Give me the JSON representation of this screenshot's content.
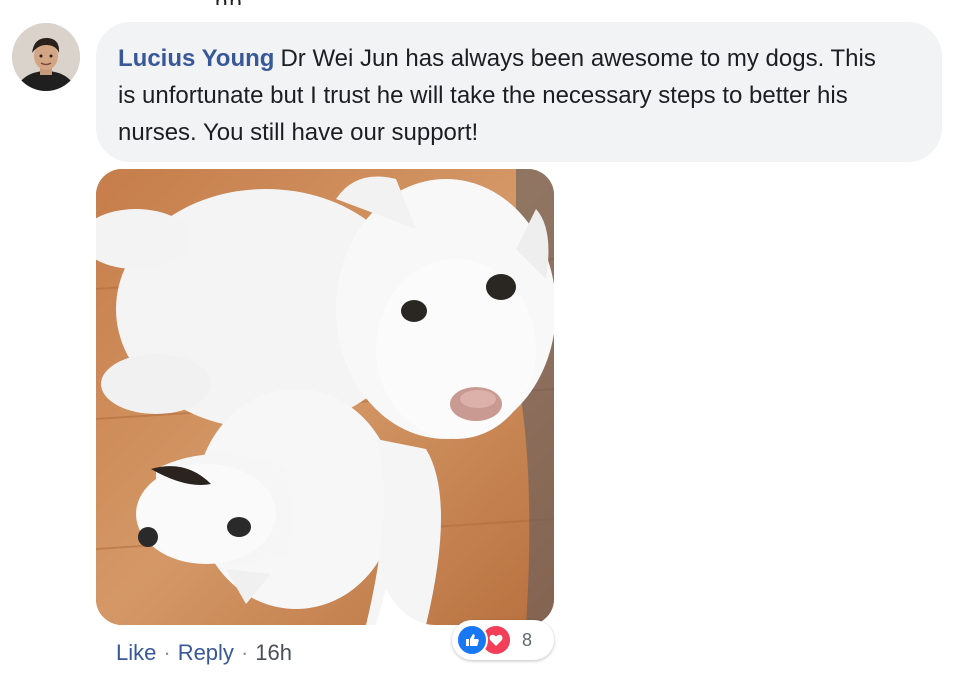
{
  "top_fragment": "pp",
  "comment": {
    "author": "Lucius Young",
    "text": "Dr Wei Jun has always been awesome to my dogs. This is unfortunate but I trust he will take the necessary steps to better his nurses. You still have our support!"
  },
  "actions": {
    "like_label": "Like",
    "reply_label": "Reply",
    "separator": "·",
    "timestamp": "16h"
  },
  "reactions": {
    "types": [
      "like-icon",
      "love-icon"
    ],
    "count": "8"
  },
  "colors": {
    "author_link": "#385898",
    "bubble_bg": "#f2f3f5",
    "like_blue": "#1877f2",
    "love_red": "#f33e58"
  }
}
